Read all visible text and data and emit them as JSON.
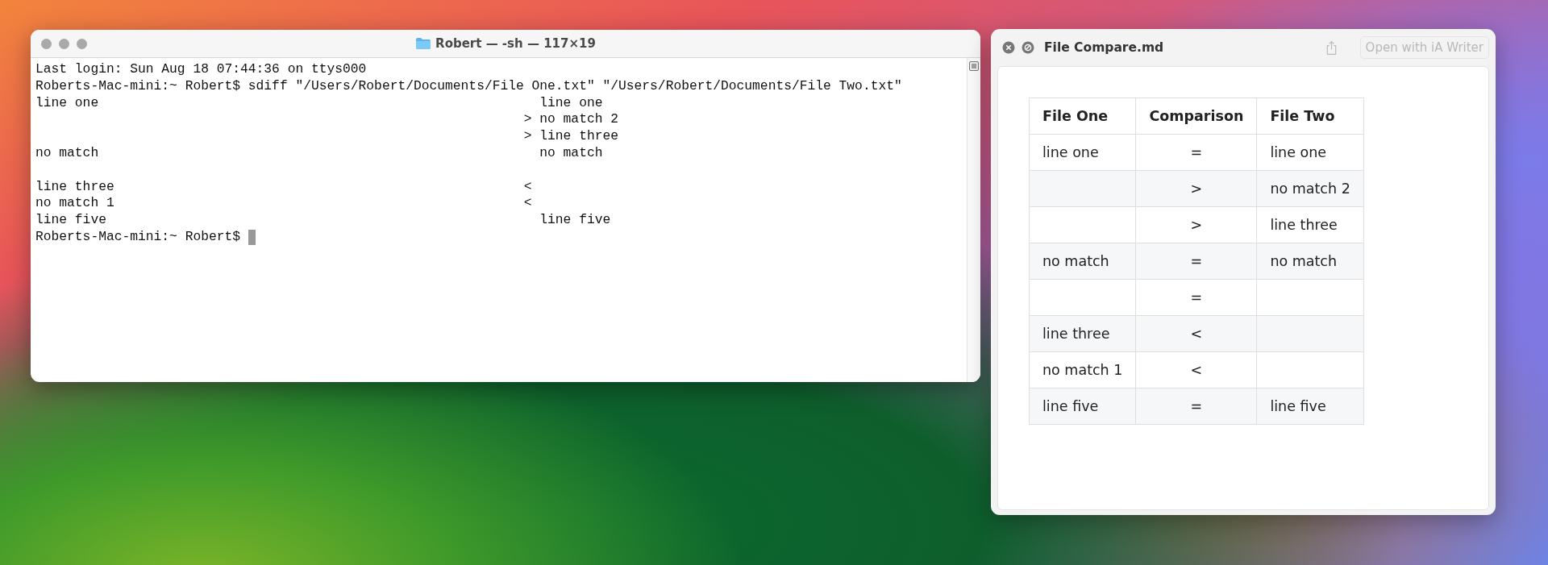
{
  "terminal": {
    "title": "Robert — -sh — 117×19",
    "lines": [
      {
        "left": "Last login: Sun Aug 18 07:44:36 on ttys000"
      },
      {
        "left": "Roberts-Mac-mini:~ Robert$ sdiff \"/Users/Robert/Documents/File One.txt\" \"/Users/Robert/Documents/File Two.txt\""
      },
      {
        "left": "line one",
        "right": "line one"
      },
      {
        "marker": ">",
        "right": "no match 2"
      },
      {
        "marker": ">",
        "right": "line three"
      },
      {
        "left": "no match",
        "right": "no match"
      },
      {
        "left": "line three",
        "marker": "<",
        "blank_line_before": true
      },
      {
        "left": "no match 1",
        "marker": "<"
      },
      {
        "left": "line five",
        "right": "line five"
      },
      {
        "left": "Roberts-Mac-mini:~ Robert$",
        "cursor": true
      }
    ]
  },
  "preview": {
    "title": "File Compare.md",
    "open_button": "Open with iA Writer",
    "table": {
      "columns": [
        "File One",
        "Comparison",
        "File Two"
      ],
      "rows": [
        {
          "file_one": "line one",
          "comparison": "=",
          "file_two": "line one"
        },
        {
          "comparison": ">",
          "file_two": "no match 2"
        },
        {
          "comparison": ">",
          "file_two": "line three"
        },
        {
          "file_one": "no match",
          "comparison": "=",
          "file_two": "no match"
        },
        {
          "comparison": "="
        },
        {
          "file_one": "line three",
          "comparison": "<"
        },
        {
          "file_one": "no match 1",
          "comparison": "<"
        },
        {
          "file_one": "line five",
          "comparison": "=",
          "file_two": "line five"
        }
      ]
    }
  }
}
